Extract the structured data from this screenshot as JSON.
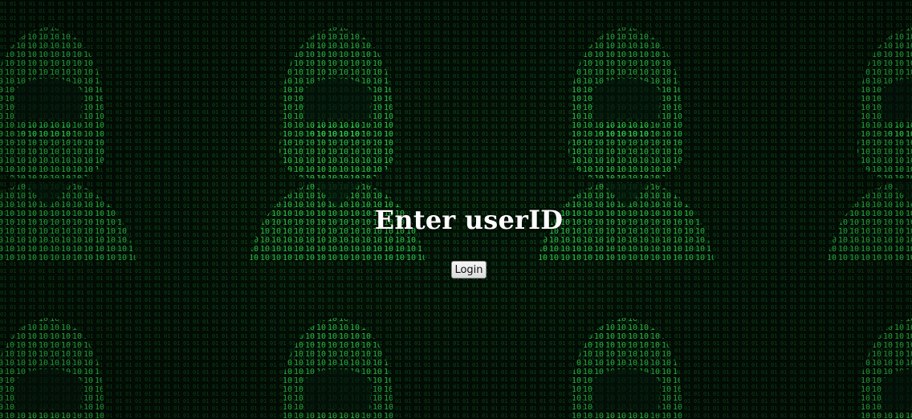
{
  "page": {
    "heading": "Enter userID",
    "login_button_label": "Login"
  },
  "theme": {
    "background": "#031006",
    "matrix_green": "#22e04a",
    "heading_color": "#ffffff"
  },
  "background": {
    "pattern": "binary-matrix-hooded-figures",
    "glyphs": "01"
  }
}
